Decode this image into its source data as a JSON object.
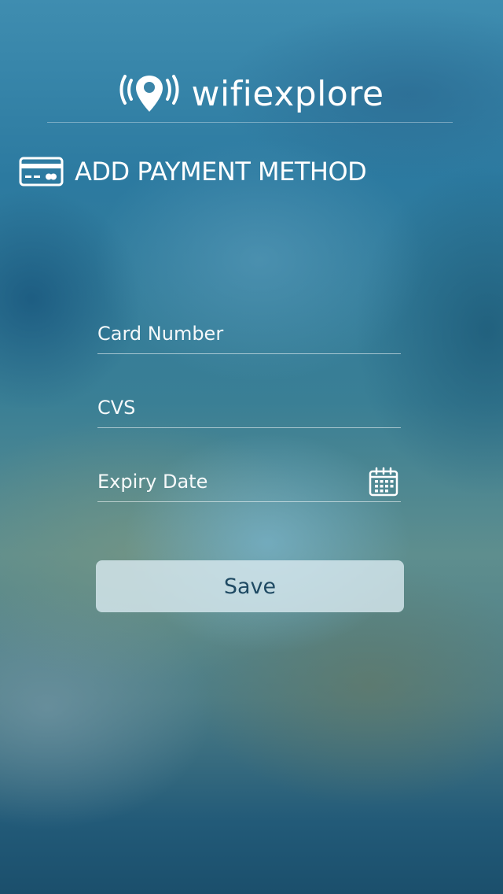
{
  "app": {
    "brand_name": "wifiexplore"
  },
  "header": {
    "title": "ADD PAYMENT METHOD",
    "icon": "credit-card-icon"
  },
  "form": {
    "card_number": {
      "value": "",
      "placeholder": "Card Number"
    },
    "cvs": {
      "value": "",
      "placeholder": "CVS"
    },
    "expiry_date": {
      "value": "",
      "placeholder": "Expiry Date",
      "icon": "calendar-icon"
    },
    "save_label": "Save"
  },
  "colors": {
    "text": "#ffffff",
    "button_background": "#d7e8ee",
    "button_text": "#1f4a63"
  }
}
